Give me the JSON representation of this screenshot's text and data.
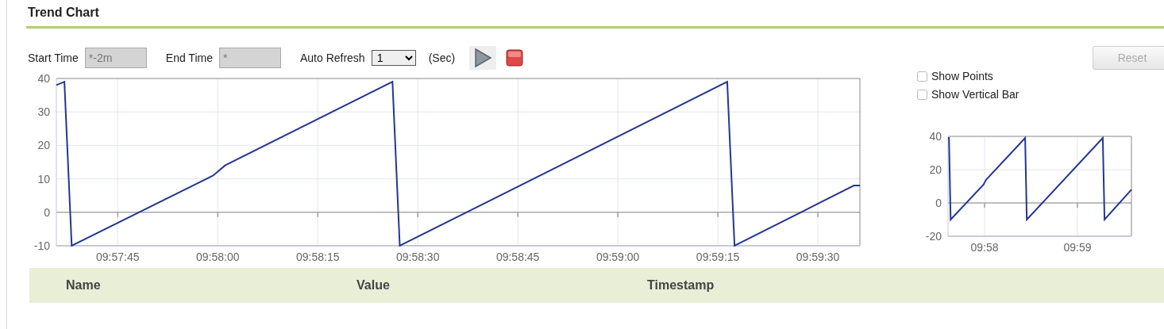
{
  "title": "Trend Chart",
  "controls": {
    "start_time": {
      "label": "Start Time",
      "value": "*-2m",
      "disabled": true
    },
    "end_time": {
      "label": "End Time",
      "value": "*",
      "disabled": true
    },
    "auto_refresh": {
      "label": "Auto Refresh",
      "value": "1",
      "unit": "(Sec)"
    },
    "reset": {
      "label": "Reset",
      "disabled": true
    }
  },
  "options": [
    {
      "label": "Show Points",
      "checked": false
    },
    {
      "label": "Show Vertical Bar",
      "checked": false
    }
  ],
  "main_chart": {
    "chart_data": {
      "type": "line",
      "x": [
        35855.8,
        35857.0,
        35858.1,
        35879.3,
        35881.1,
        35906.2,
        35907.3,
        35956.4,
        35957.5,
        35975.4,
        35976.3
      ],
      "series": [
        {
          "color": "#22388f",
          "values": [
            38,
            39,
            -10,
            11,
            14,
            39,
            -10,
            39,
            -10,
            8,
            8
          ]
        }
      ],
      "grid": true,
      "xlim": [
        35855.8,
        35976.3
      ],
      "ylim": [
        -10,
        40
      ],
      "xticks": [
        {
          "value": 35865,
          "label": "09:57:45"
        },
        {
          "value": 35880,
          "label": "09:58:00"
        },
        {
          "value": 35895,
          "label": "09:58:15"
        },
        {
          "value": 35910,
          "label": "09:58:30"
        },
        {
          "value": 35925,
          "label": "09:58:45"
        },
        {
          "value": 35940,
          "label": "09:59:00"
        },
        {
          "value": 35955,
          "label": "09:59:15"
        },
        {
          "value": 35970,
          "label": "09:59:30"
        }
      ],
      "yticks": [
        -10,
        0,
        10,
        20,
        30,
        40
      ]
    }
  },
  "overview_chart": {
    "chart_data": {
      "type": "line",
      "x": [
        35856.4,
        35857.0,
        35858.1,
        35879.3,
        35881.1,
        35906.2,
        35907.3,
        35956.4,
        35957.5,
        35974.9
      ],
      "series": [
        {
          "color": "#22388f",
          "values": [
            39,
            39,
            -10,
            11,
            14,
            39,
            -10,
            39,
            -10,
            8
          ]
        }
      ],
      "grid": true,
      "xlim": [
        35856.4,
        35974.9
      ],
      "ylim": [
        -20,
        40
      ],
      "xticks": [
        {
          "value": 35880,
          "label": "09:58"
        },
        {
          "value": 35940,
          "label": "09:59"
        }
      ],
      "yticks": [
        -20,
        0,
        20,
        40
      ]
    }
  },
  "table": {
    "columns": [
      "Name",
      "Value",
      "Timestamp"
    ]
  }
}
